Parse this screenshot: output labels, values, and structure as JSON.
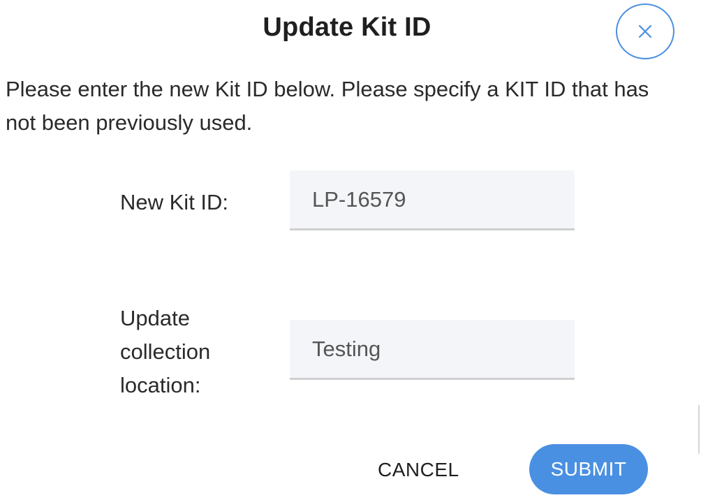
{
  "dialog": {
    "title": "Update Kit ID",
    "instructions": "Please enter the new Kit ID below. Please specify a KIT ID that has not been previously used.",
    "close_icon": "close-icon"
  },
  "form": {
    "kit_id": {
      "label": "New Kit ID:",
      "value": "LP-16579"
    },
    "collection_location": {
      "label": "Update collection location:",
      "value": "Testing"
    }
  },
  "actions": {
    "cancel_label": "CANCEL",
    "submit_label": "SUBMIT"
  },
  "colors": {
    "accent": "#4a90e2",
    "input_background": "#f4f5f8",
    "input_underline": "#cfcfcf",
    "text": "#2a2a2a"
  }
}
